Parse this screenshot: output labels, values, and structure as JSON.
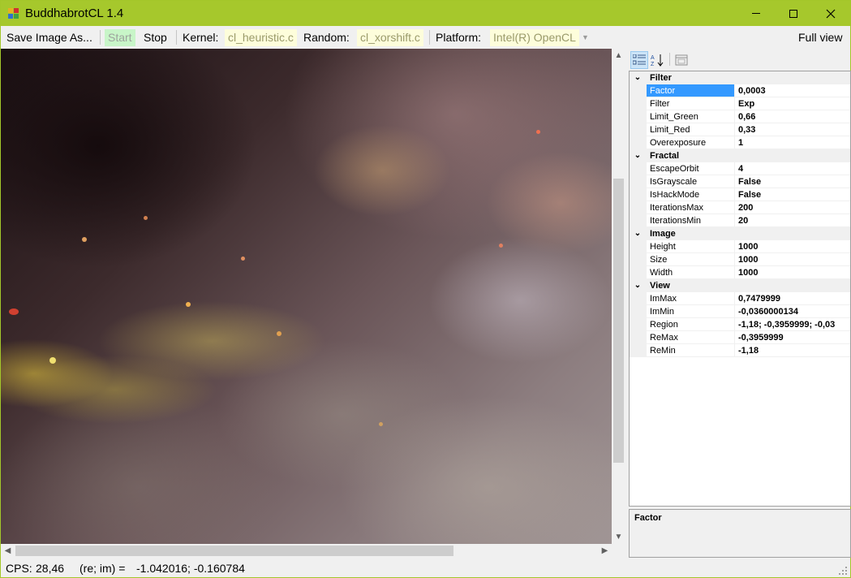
{
  "window": {
    "title": "BuddhabrotCL 1.4"
  },
  "toolbar": {
    "save_label": "Save Image As...",
    "start_label": "Start",
    "stop_label": "Stop",
    "kernel_label": "Kernel:",
    "kernel_value": "cl_heuristic.c",
    "random_label": "Random:",
    "random_value": "cl_xorshift.c",
    "platform_label": "Platform:",
    "platform_value": "Intel(R) OpenCL",
    "fullview_label": "Full view"
  },
  "property_grid": {
    "categories": [
      {
        "name": "Filter",
        "props": [
          {
            "name": "Factor",
            "value": "0,0003"
          },
          {
            "name": "Filter",
            "value": "Exp"
          },
          {
            "name": "Limit_Green",
            "value": "0,66"
          },
          {
            "name": "Limit_Red",
            "value": "0,33"
          },
          {
            "name": "Overexposure",
            "value": "1"
          }
        ]
      },
      {
        "name": "Fractal",
        "props": [
          {
            "name": "EscapeOrbit",
            "value": "4"
          },
          {
            "name": "IsGrayscale",
            "value": "False"
          },
          {
            "name": "IsHackMode",
            "value": "False"
          },
          {
            "name": "IterationsMax",
            "value": "200"
          },
          {
            "name": "IterationsMin",
            "value": "20"
          }
        ]
      },
      {
        "name": "Image",
        "props": [
          {
            "name": "Height",
            "value": "1000"
          },
          {
            "name": "Size",
            "value": "1000"
          },
          {
            "name": "Width",
            "value": "1000"
          }
        ]
      },
      {
        "name": "View",
        "props": [
          {
            "name": "ImMax",
            "value": "0,7479999"
          },
          {
            "name": "ImMin",
            "value": "-0,0360000134"
          },
          {
            "name": "Region",
            "value": "-1,18; -0,3959999; -0,03"
          },
          {
            "name": "ReMax",
            "value": "-0,3959999"
          },
          {
            "name": "ReMin",
            "value": "-1,18"
          }
        ]
      }
    ],
    "description_title": "Factor"
  },
  "status": {
    "cps_label": "CPS:",
    "cps_value": "28,46",
    "coord_label": "(re; im) =",
    "coord_value": "-1.042016; -0.160784"
  },
  "icons": {
    "app": "buddhabrot-app-icon",
    "categorized": "categorized-view-icon",
    "alphabetical": "alphabetical-sort-icon",
    "property_pages": "property-pages-icon"
  }
}
